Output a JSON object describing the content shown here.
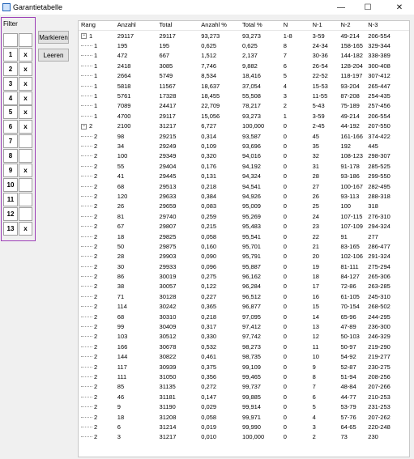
{
  "window": {
    "title": "Garantietabelle",
    "minimize_glyph": "—",
    "maximize_glyph": "☐",
    "close_glyph": "✕"
  },
  "filter": {
    "label": "Filter",
    "rows": [
      {
        "n": "1",
        "m": "x"
      },
      {
        "n": "2",
        "m": "x"
      },
      {
        "n": "3",
        "m": "x"
      },
      {
        "n": "4",
        "m": "x"
      },
      {
        "n": "5",
        "m": "x"
      },
      {
        "n": "6",
        "m": "x"
      },
      {
        "n": "7",
        "m": ""
      },
      {
        "n": "8",
        "m": ""
      },
      {
        "n": "9",
        "m": "x"
      },
      {
        "n": "10",
        "m": ""
      },
      {
        "n": "11",
        "m": ""
      },
      {
        "n": "12",
        "m": ""
      },
      {
        "n": "13",
        "m": "x"
      }
    ]
  },
  "buttons": {
    "mark": "Markieren",
    "clear": "Leeren"
  },
  "table": {
    "columns": [
      "Rang",
      "Anzahl",
      "Total",
      "Anzahl %",
      "Total %",
      "N",
      "N-1",
      "N-2",
      "N-3"
    ],
    "rows": [
      {
        "lvl": 0,
        "exp": "−",
        "c": [
          "1",
          "29117",
          "29117",
          "93,273",
          "93,273",
          "1-8",
          "3-59",
          "49-214",
          "206-554"
        ]
      },
      {
        "lvl": 1,
        "c": [
          "1",
          "195",
          "195",
          "0,625",
          "0,625",
          "8",
          "24-34",
          "158-165",
          "329-344"
        ]
      },
      {
        "lvl": 1,
        "c": [
          "1",
          "472",
          "667",
          "1,512",
          "2,137",
          "7",
          "30-36",
          "144-182",
          "338-389"
        ]
      },
      {
        "lvl": 1,
        "c": [
          "1",
          "2418",
          "3085",
          "7,746",
          "9,882",
          "6",
          "26-54",
          "128-204",
          "300-408"
        ]
      },
      {
        "lvl": 1,
        "c": [
          "1",
          "2664",
          "5749",
          "8,534",
          "18,416",
          "5",
          "22-52",
          "118-197",
          "307-412"
        ]
      },
      {
        "lvl": 1,
        "c": [
          "1",
          "5818",
          "11567",
          "18,637",
          "37,054",
          "4",
          "15-53",
          "93-204",
          "265-447"
        ]
      },
      {
        "lvl": 1,
        "c": [
          "1",
          "5761",
          "17328",
          "18,455",
          "55,508",
          "3",
          "11-55",
          "87-208",
          "254-435"
        ]
      },
      {
        "lvl": 1,
        "c": [
          "1",
          "7089",
          "24417",
          "22,709",
          "78,217",
          "2",
          "5-43",
          "75-189",
          "257-456"
        ]
      },
      {
        "lvl": 1,
        "c": [
          "1",
          "4700",
          "29117",
          "15,056",
          "93,273",
          "1",
          "3-59",
          "49-214",
          "206-554"
        ]
      },
      {
        "lvl": 0,
        "exp": "−",
        "c": [
          "2",
          "2100",
          "31217",
          "6,727",
          "100,000",
          "0",
          "2-45",
          "44-192",
          "207-550"
        ]
      },
      {
        "lvl": 1,
        "c": [
          "2",
          "98",
          "29215",
          "0,314",
          "93,587",
          "0",
          "45",
          "161-166",
          "374-422"
        ]
      },
      {
        "lvl": 1,
        "c": [
          "2",
          "34",
          "29249",
          "0,109",
          "93,696",
          "0",
          "35",
          "192",
          "445"
        ]
      },
      {
        "lvl": 1,
        "c": [
          "2",
          "100",
          "29349",
          "0,320",
          "94,016",
          "0",
          "32",
          "108-123",
          "298-307"
        ]
      },
      {
        "lvl": 1,
        "c": [
          "2",
          "55",
          "29404",
          "0,176",
          "94,192",
          "0",
          "31",
          "91-178",
          "285-525"
        ]
      },
      {
        "lvl": 1,
        "c": [
          "2",
          "41",
          "29445",
          "0,131",
          "94,324",
          "0",
          "28",
          "93-186",
          "299-550"
        ]
      },
      {
        "lvl": 1,
        "c": [
          "2",
          "68",
          "29513",
          "0,218",
          "94,541",
          "0",
          "27",
          "100-167",
          "282-495"
        ]
      },
      {
        "lvl": 1,
        "c": [
          "2",
          "120",
          "29633",
          "0,384",
          "94,926",
          "0",
          "26",
          "93-113",
          "288-318"
        ]
      },
      {
        "lvl": 1,
        "c": [
          "2",
          "26",
          "29659",
          "0,083",
          "95,009",
          "0",
          "25",
          "100",
          "318"
        ]
      },
      {
        "lvl": 1,
        "c": [
          "2",
          "81",
          "29740",
          "0,259",
          "95,269",
          "0",
          "24",
          "107-115",
          "276-310"
        ]
      },
      {
        "lvl": 1,
        "c": [
          "2",
          "67",
          "29807",
          "0,215",
          "95,483",
          "0",
          "23",
          "107-109",
          "294-324"
        ]
      },
      {
        "lvl": 1,
        "c": [
          "2",
          "18",
          "29825",
          "0,058",
          "95,541",
          "0",
          "22",
          "91",
          "277"
        ]
      },
      {
        "lvl": 1,
        "c": [
          "2",
          "50",
          "29875",
          "0,160",
          "95,701",
          "0",
          "21",
          "83-165",
          "286-477"
        ]
      },
      {
        "lvl": 1,
        "c": [
          "2",
          "28",
          "29903",
          "0,090",
          "95,791",
          "0",
          "20",
          "102-106",
          "291-324"
        ]
      },
      {
        "lvl": 1,
        "c": [
          "2",
          "30",
          "29933",
          "0,096",
          "95,887",
          "0",
          "19",
          "81-111",
          "275-294"
        ]
      },
      {
        "lvl": 1,
        "c": [
          "2",
          "86",
          "30019",
          "0,275",
          "96,162",
          "0",
          "18",
          "84-127",
          "265-306"
        ]
      },
      {
        "lvl": 1,
        "c": [
          "2",
          "38",
          "30057",
          "0,122",
          "96,284",
          "0",
          "17",
          "72-86",
          "263-285"
        ]
      },
      {
        "lvl": 1,
        "c": [
          "2",
          "71",
          "30128",
          "0,227",
          "96,512",
          "0",
          "16",
          "61-105",
          "245-310"
        ]
      },
      {
        "lvl": 1,
        "c": [
          "2",
          "114",
          "30242",
          "0,365",
          "96,877",
          "0",
          "15",
          "70-154",
          "268-502"
        ]
      },
      {
        "lvl": 1,
        "c": [
          "2",
          "68",
          "30310",
          "0,218",
          "97,095",
          "0",
          "14",
          "65-96",
          "244-295"
        ]
      },
      {
        "lvl": 1,
        "c": [
          "2",
          "99",
          "30409",
          "0,317",
          "97,412",
          "0",
          "13",
          "47-89",
          "236-300"
        ]
      },
      {
        "lvl": 1,
        "c": [
          "2",
          "103",
          "30512",
          "0,330",
          "97,742",
          "0",
          "12",
          "50-103",
          "246-329"
        ]
      },
      {
        "lvl": 1,
        "c": [
          "2",
          "166",
          "30678",
          "0,532",
          "98,273",
          "0",
          "11",
          "50-97",
          "219-290"
        ]
      },
      {
        "lvl": 1,
        "c": [
          "2",
          "144",
          "30822",
          "0,461",
          "98,735",
          "0",
          "10",
          "54-92",
          "219-277"
        ]
      },
      {
        "lvl": 1,
        "c": [
          "2",
          "117",
          "30939",
          "0,375",
          "99,109",
          "0",
          "9",
          "52-87",
          "230-275"
        ]
      },
      {
        "lvl": 1,
        "c": [
          "2",
          "111",
          "31050",
          "0,356",
          "99,465",
          "0",
          "8",
          "51-94",
          "208-256"
        ]
      },
      {
        "lvl": 1,
        "c": [
          "2",
          "85",
          "31135",
          "0,272",
          "99,737",
          "0",
          "7",
          "48-84",
          "207-266"
        ]
      },
      {
        "lvl": 1,
        "c": [
          "2",
          "46",
          "31181",
          "0,147",
          "99,885",
          "0",
          "6",
          "44-77",
          "210-253"
        ]
      },
      {
        "lvl": 1,
        "c": [
          "2",
          "9",
          "31190",
          "0,029",
          "99,914",
          "0",
          "5",
          "53-79",
          "231-253"
        ]
      },
      {
        "lvl": 1,
        "c": [
          "2",
          "18",
          "31208",
          "0,058",
          "99,971",
          "0",
          "4",
          "57-76",
          "207-262"
        ]
      },
      {
        "lvl": 1,
        "c": [
          "2",
          "6",
          "31214",
          "0,019",
          "99,990",
          "0",
          "3",
          "64-65",
          "220-248"
        ]
      },
      {
        "lvl": 1,
        "c": [
          "2",
          "3",
          "31217",
          "0,010",
          "100,000",
          "0",
          "2",
          "73",
          "230"
        ]
      }
    ]
  }
}
